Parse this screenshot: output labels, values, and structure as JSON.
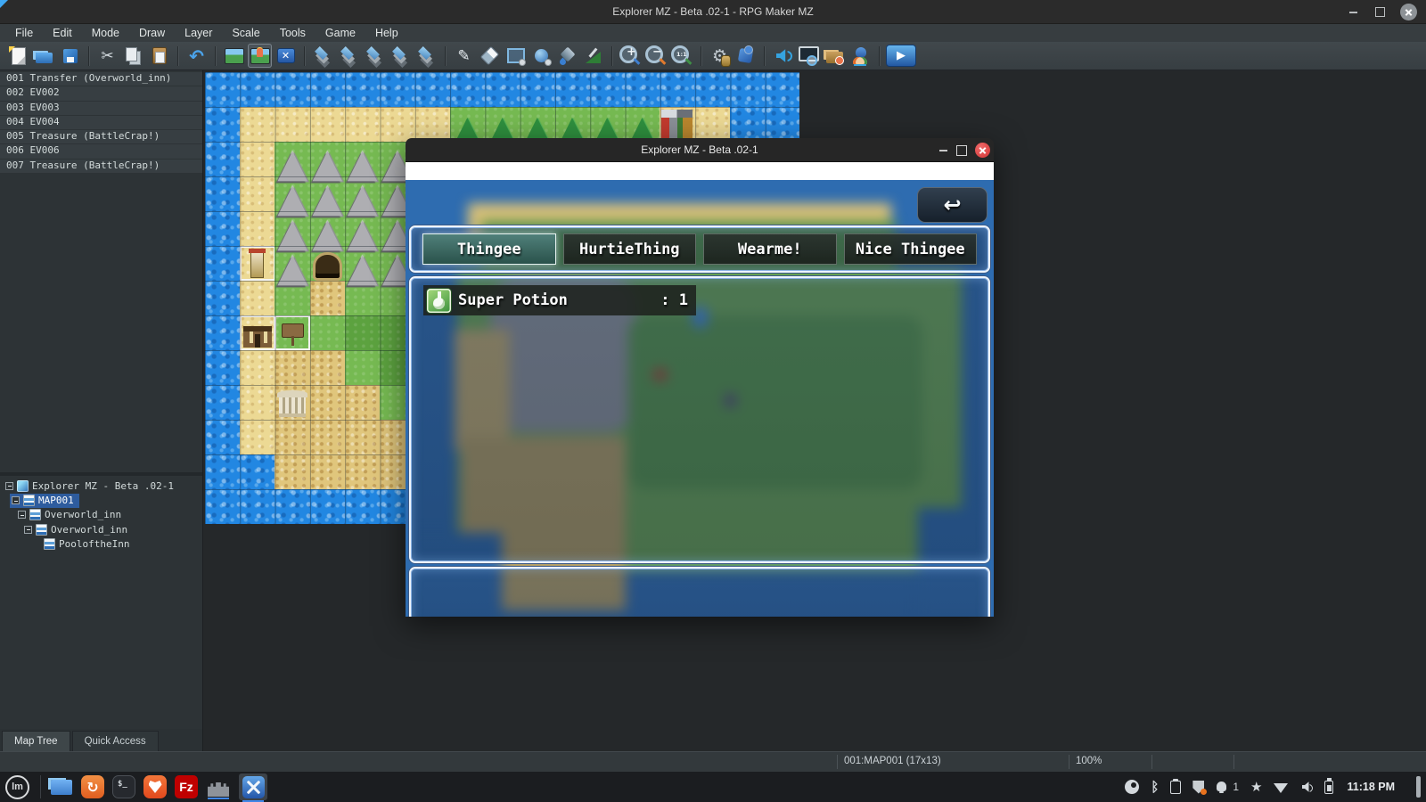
{
  "titlebar": {
    "title": "Explorer MZ - Beta .02-1  - RPG Maker MZ"
  },
  "menubar": {
    "items": [
      "File",
      "Edit",
      "Mode",
      "Draw",
      "Layer",
      "Scale",
      "Tools",
      "Game",
      "Help"
    ]
  },
  "toolbar": {
    "groups": [
      [
        "new-project",
        "open-project",
        "save-project"
      ],
      [
        "cut",
        "copy",
        "paste"
      ],
      [
        "undo"
      ],
      [
        "map-mode",
        "event-mode",
        "region-mode"
      ],
      [
        "layer-1",
        "layer-2",
        "layer-3",
        "layer-4",
        "layer-5"
      ],
      [
        "pencil-tool",
        "eraser-tool",
        "rectangle-tool",
        "ellipse-tool",
        "flood-fill-tool",
        "shadow-pen-tool"
      ],
      [
        "zoom-in",
        "zoom-out",
        "zoom-actual"
      ],
      [
        "database",
        "plugin-manager"
      ],
      [
        "sound-test",
        "event-searcher",
        "resource-manager",
        "character-generator"
      ],
      [
        "playtest"
      ]
    ],
    "active_button": "event-mode"
  },
  "icons": {
    "cut": "✂",
    "undo": "↶",
    "pencil-tool": "✎",
    "database": "⚙",
    "playtest": "▶",
    "region_x": "✕",
    "zoom_plus": "+",
    "zoom_minus": "−",
    "zoom_actual": "1:1",
    "back_arrow": "↩",
    "mountain": "▲",
    "tree": "▲",
    "mint": "lm",
    "terminal": "$_",
    "filezilla": "Fz",
    "timeshift": "↻",
    "bluetooth": "ᛒ",
    "star": "★"
  },
  "event_list": [
    {
      "num": "001",
      "label": "Transfer (Overworld_inn)"
    },
    {
      "num": "002",
      "label": "EV002"
    },
    {
      "num": "003",
      "label": "EV003"
    },
    {
      "num": "004",
      "label": "EV004"
    },
    {
      "num": "005",
      "label": "Treasure (BattleCrap!)"
    },
    {
      "num": "006",
      "label": "EV006"
    },
    {
      "num": "007",
      "label": "Treasure (BattleCrap!)"
    }
  ],
  "map_tree": [
    {
      "label": "Explorer MZ - Beta .02-1",
      "depth": 0,
      "expander": true,
      "icon": "project",
      "selected": false
    },
    {
      "label": "MAP001",
      "depth": 1,
      "expander": true,
      "icon": "map",
      "selected": true
    },
    {
      "label": "Overworld_inn",
      "depth": 2,
      "expander": true,
      "icon": "map",
      "selected": false
    },
    {
      "label": "Overworld_inn",
      "depth": 3,
      "expander": true,
      "icon": "map",
      "selected": false
    },
    {
      "label": "PooloftheInn",
      "depth": 4,
      "expander": false,
      "icon": "map",
      "selected": false
    }
  ],
  "panel_tabs": {
    "tabs": [
      "Map Tree",
      "Quick Access"
    ],
    "active": 0
  },
  "map_canvas": {
    "cols": 17,
    "rows": 13,
    "tiles": [
      "WWWWWWWWWWWWWWWWW",
      "WSSSSSSTTTTTTBSWW",
      "WSMMMMMGGGGGGGSWW",
      "WSMMMMMGGGGGGGSWW",
      "WSMMMMMGgggGGGSWW",
      "WEMCMMGGgggGGGSWW",
      "WSGDGGGGgggGGGSWW",
      "WINGggGGGGGGGGSWW",
      "WSDDGgGGGGGGGGSWW",
      "WSPDDGGGGGGGGGSWW",
      "WSDDDDGGGGGGGGSWW",
      "WWDDDDSSSSSSSSWWW",
      "WWWWWWWWWWWWWWWWW"
    ]
  },
  "game": {
    "title": "Explorer MZ - Beta .02-1",
    "tabs": [
      {
        "label": "Thingee",
        "selected": true
      },
      {
        "label": "HurtieThing",
        "selected": false
      },
      {
        "label": "Wearme!",
        "selected": false
      },
      {
        "label": "Nice Thingee",
        "selected": false
      }
    ],
    "item": {
      "name": "Super Potion",
      "qty": ": 1"
    }
  },
  "statusbar": {
    "map_info": "001:MAP001 (17x13)",
    "zoom_level": "100%"
  },
  "taskbar": {
    "apps": [
      "mint-menu",
      "files",
      "timeshift",
      "terminal",
      "brave",
      "filezilla",
      "rpg-maker",
      "editor-active"
    ],
    "tray": [
      "steam",
      "bluetooth",
      "clipboard",
      "shield",
      "notifications",
      "star",
      "wifi",
      "volume",
      "battery"
    ],
    "notification_count": "1",
    "clock": "11:18 PM"
  }
}
